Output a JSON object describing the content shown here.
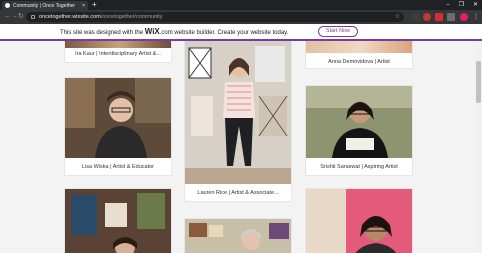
{
  "browser": {
    "tab_title": "Community | Once Together",
    "tab_close": "×",
    "new_tab": "+",
    "url_host": "oncetogether.wixsite.com",
    "url_path": "/oncetogether/community",
    "win_min": "–",
    "win_max": "❐",
    "win_close": "✕"
  },
  "banner": {
    "text_before": "This site was designed with the ",
    "brand": "WiX",
    "text_after": ".com website builder. Create your website today.",
    "button": "Start Now",
    "accent_color": "#7b3ba6"
  },
  "cards": [
    {
      "caption": "Ira Kaur | Interdisciplinary Artist &..."
    },
    {
      "caption": "Anna Demovidova | Artist"
    },
    {
      "caption": "Lisa Wiska | Artist & Educator"
    },
    {
      "caption": "Lauren Rice | Artist & Associate..."
    },
    {
      "caption": "Srishti Saraswat | Aspiring Artist"
    },
    {
      "caption": ""
    },
    {
      "caption": ""
    },
    {
      "caption": ""
    }
  ]
}
